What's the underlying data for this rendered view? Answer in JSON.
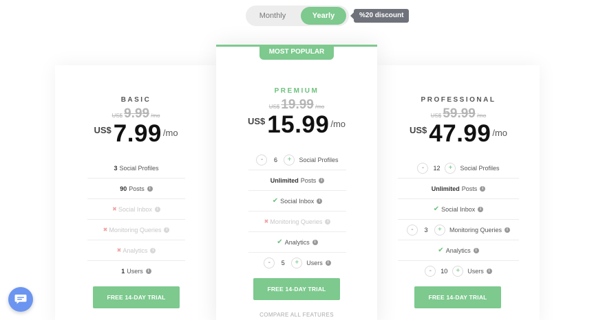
{
  "toggle": {
    "monthly": "Monthly",
    "yearly": "Yearly",
    "discount": "%20 discount"
  },
  "colors": {
    "accent": "#7dc98e",
    "discount_bg": "#6f727a",
    "chat": "#6b95f0"
  },
  "plans": {
    "basic": {
      "name": "BASIC",
      "old_currency": "US$",
      "old_price": "9.99",
      "old_period": "/mo",
      "currency": "US$",
      "price": "7.99",
      "period": "/mo",
      "features": {
        "social_profiles": {
          "count": "3",
          "label": "Social Profiles"
        },
        "posts": {
          "count": "90",
          "label": "Posts"
        },
        "social_inbox": "Social Inbox",
        "monitoring": "Monitoring Queries",
        "analytics": "Analytics",
        "users": {
          "count": "1",
          "label": "Users"
        }
      },
      "cta": "FREE 14-DAY TRIAL"
    },
    "premium": {
      "badge": "MOST POPULAR",
      "name": "PREMIUM",
      "old_currency": "US$",
      "old_price": "19.99",
      "old_period": "/mo",
      "currency": "US$",
      "price": "15.99",
      "period": "/mo",
      "features": {
        "social_profiles": {
          "count": "6",
          "label": "Social Profiles"
        },
        "posts": {
          "count": "Unlimited",
          "label": "Posts"
        },
        "social_inbox": "Social Inbox",
        "monitoring": "Monitoring Queries",
        "analytics": "Analytics",
        "users": {
          "count": "5",
          "label": "Users"
        }
      },
      "cta": "FREE 14-DAY TRIAL",
      "compare": "COMPARE ALL FEATURES"
    },
    "pro": {
      "name": "PROFESSIONAL",
      "old_currency": "US$",
      "old_price": "59.99",
      "old_period": "/mo",
      "currency": "US$",
      "price": "47.99",
      "period": "/mo",
      "features": {
        "social_profiles": {
          "count": "12",
          "label": "Social Profiles"
        },
        "posts": {
          "count": "Unlimited",
          "label": "Posts"
        },
        "social_inbox": "Social Inbox",
        "monitoring": {
          "count": "3",
          "label": "Monitoring Queries"
        },
        "analytics": "Analytics",
        "users": {
          "count": "10",
          "label": "Users"
        }
      },
      "cta": "FREE 14-DAY TRIAL"
    }
  },
  "icons": {
    "info": "info-icon",
    "check": "check-icon",
    "cross": "cross-icon",
    "minus": "minus-icon",
    "plus": "plus-icon",
    "chat": "chat-bubble-icon"
  },
  "glyphs": {
    "info": "i",
    "check": "✔",
    "cross": "✖",
    "minus": "-",
    "plus": "+"
  }
}
